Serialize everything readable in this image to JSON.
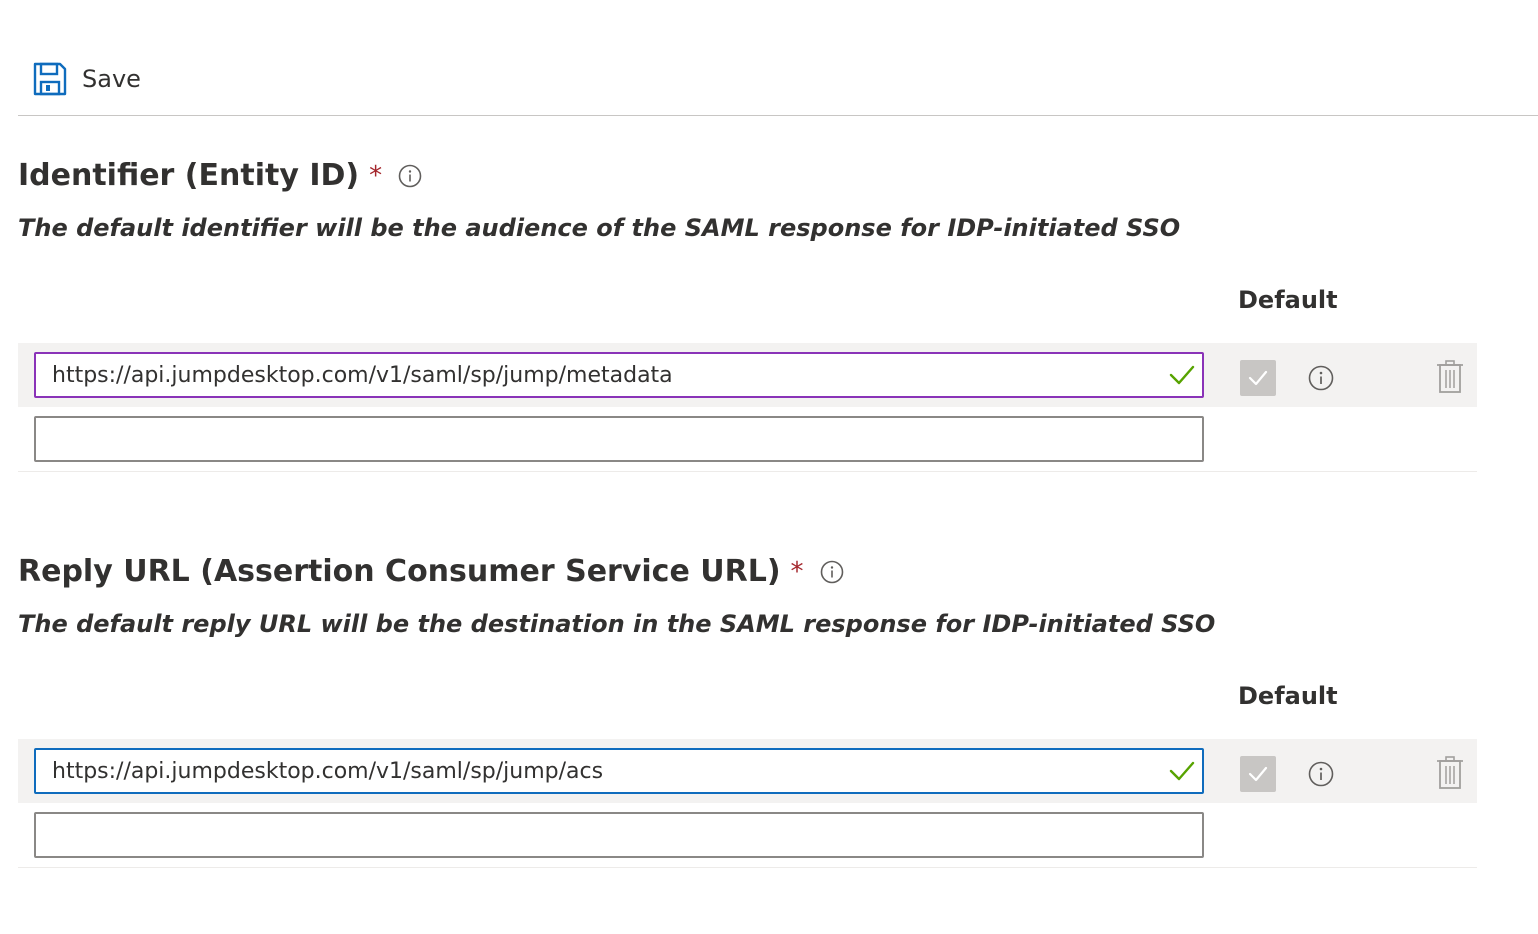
{
  "toolbar": {
    "save_label": "Save",
    "save_icon": "save-icon",
    "accent_color": "#0f6cbd"
  },
  "identifier": {
    "title": "Identifier (Entity ID)",
    "required_mark": "*",
    "description": "The default identifier will be the audience of the SAML response for IDP-initiated SSO",
    "default_header": "Default",
    "rows": [
      {
        "value": "https://api.jumpdesktop.com/v1/saml/sp/jump/metadata",
        "is_default": true,
        "valid": true
      },
      {
        "value": "",
        "placeholder": ""
      }
    ]
  },
  "reply_url": {
    "title": "Reply URL (Assertion Consumer Service URL)",
    "required_mark": "*",
    "description": "The default reply URL will be the destination in the SAML response for IDP-initiated SSO",
    "default_header": "Default",
    "rows": [
      {
        "value": "https://api.jumpdesktop.com/v1/saml/sp/jump/acs",
        "is_default": true,
        "valid": true
      },
      {
        "value": "",
        "placeholder": ""
      }
    ]
  },
  "colors": {
    "required": "#a4262c",
    "valid_check": "#57a300",
    "identifier_focus_border": "#8a33b8",
    "reply_focus_border": "#0f6cbd"
  }
}
